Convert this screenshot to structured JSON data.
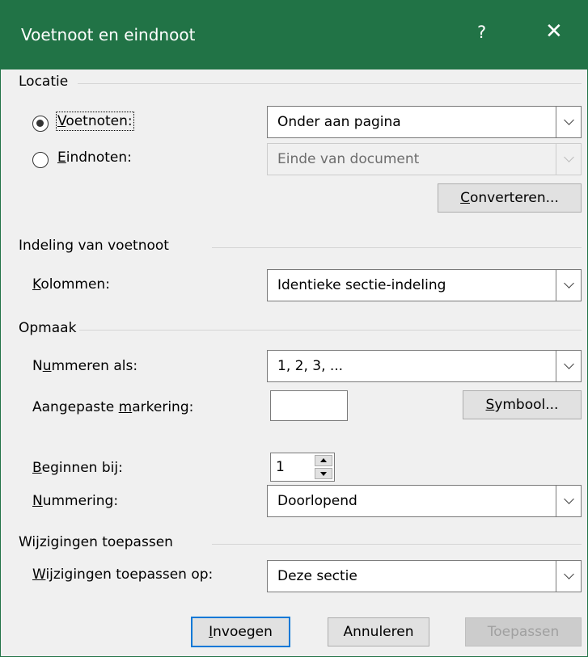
{
  "titlebar": {
    "title": "Voetnoot en eindnoot",
    "help": "?",
    "close": "✕"
  },
  "location": {
    "heading": "Locatie",
    "footnotes": {
      "label_key": "V",
      "label_rest": "oetnoten:",
      "value": "Onder aan pagina",
      "checked": true
    },
    "endnotes": {
      "label_key": "E",
      "label_rest": "indnoten:",
      "value": "Einde van document",
      "checked": false
    },
    "convert_key": "C",
    "convert_rest": "onverteren..."
  },
  "layout": {
    "heading": "Indeling van voetnoot",
    "columns_key": "K",
    "columns_rest": "olommen:",
    "columns_value": "Identieke sectie-indeling"
  },
  "format": {
    "heading": "Opmaak",
    "number_format_pre": "N",
    "number_format_key": "u",
    "number_format_rest": "mmeren als:",
    "number_format_value": "1, 2, 3, ...",
    "custom_mark_pre": "Aangepaste ",
    "custom_mark_key": "m",
    "custom_mark_rest": "arkering:",
    "custom_mark_value": "",
    "symbol_key": "S",
    "symbol_rest": "ymbool...",
    "start_at_key": "B",
    "start_at_rest": "eginnen bij:",
    "start_at_value": "1",
    "numbering_key": "N",
    "numbering_rest": "ummering:",
    "numbering_value": "Doorlopend"
  },
  "apply": {
    "heading": "Wijzigingen toepassen",
    "apply_to_key": "W",
    "apply_to_rest": "ijzigingen toepassen op:",
    "apply_to_value": "Deze sectie"
  },
  "buttons": {
    "insert_key": "I",
    "insert_rest": "nvoegen",
    "cancel": "Annuleren",
    "apply": "Toepassen"
  }
}
